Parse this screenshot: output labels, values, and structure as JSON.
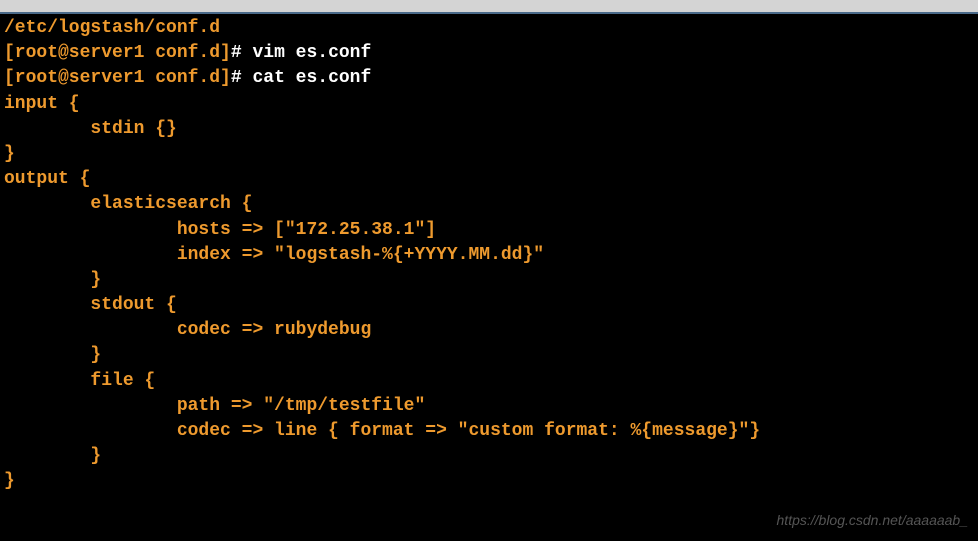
{
  "titlebar": {},
  "terminal": {
    "path": "/etc/logstash/conf.d",
    "prompt1": {
      "prefix": "[root@server1 conf.d]",
      "hash": "#",
      "command": "vim es.conf"
    },
    "prompt2": {
      "prefix": "[root@server1 conf.d]",
      "hash": "#",
      "command": "cat es.conf"
    },
    "config": {
      "line1": "input {",
      "line2": "        stdin {}",
      "line3": "}",
      "line4": "",
      "line5": "output {",
      "line6": "        elasticsearch {",
      "line7": "                hosts => [\"172.25.38.1\"]",
      "line8": "                index => \"logstash-%{+YYYY.MM.dd}\"",
      "line9": "        }",
      "line10": "",
      "line11": "        stdout {",
      "line12": "                codec => rubydebug",
      "line13": "        }",
      "line14": "        file {",
      "line15": "                path => \"/tmp/testfile\"",
      "line16": "                codec => line { format => \"custom format: %{message}\"}",
      "line17": "        }",
      "line18": "}"
    }
  },
  "watermark": "https://blog.csdn.net/aaaaaab_"
}
